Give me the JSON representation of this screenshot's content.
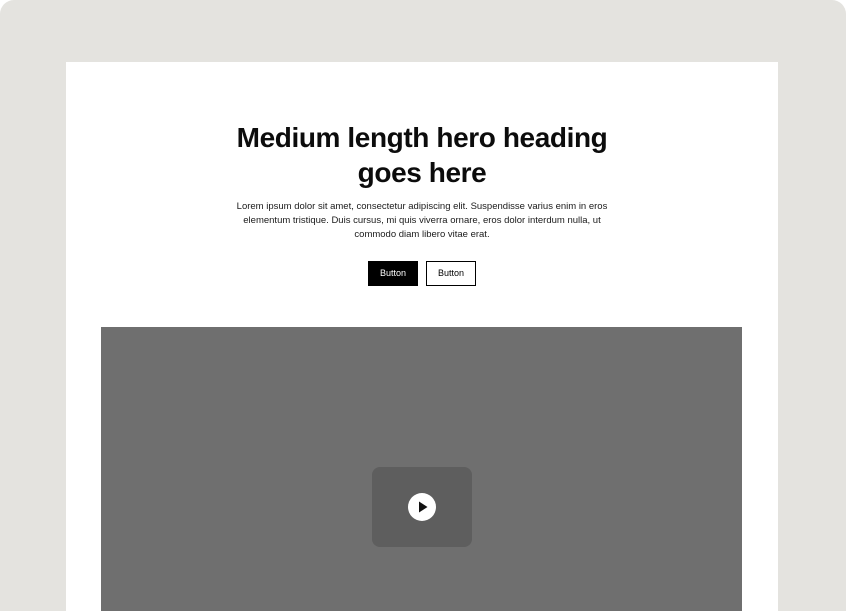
{
  "hero": {
    "heading_line1": "Medium length hero heading",
    "heading_line2": "goes here",
    "body": "Lorem ipsum dolor sit amet, consectetur adipiscing elit. Suspendisse varius enim in eros elementum tristique. Duis cursus, mi quis viverra ornare, eros dolor interdum nulla, ut commodo diam libero vitae erat.",
    "primary_button": "Button",
    "secondary_button": "Button"
  },
  "media": {
    "play_icon": "play-icon"
  },
  "colors": {
    "frame_background": "#e4e3df",
    "page_background": "#ffffff",
    "media_placeholder": "#6f6f6f",
    "play_button_background": "#5e5e5e",
    "primary_button": "#000000"
  }
}
